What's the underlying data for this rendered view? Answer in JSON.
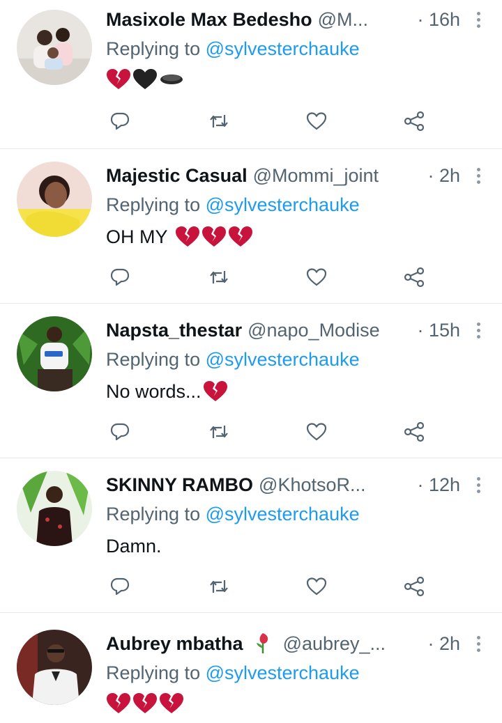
{
  "reply_prefix": "Replying to",
  "colors": {
    "accent": "#1d9bf0",
    "secondary_text": "#536471",
    "broken_heart": "#c8143c"
  },
  "tweets": [
    {
      "name": "Masixole Max Bedesho",
      "handle": "@M...",
      "time": "· 16h",
      "replying_to": "@sylvesterchauke",
      "text": "",
      "emoji": [
        "broken-heart",
        "black-heart",
        "hole"
      ]
    },
    {
      "name": "Majestic Casual",
      "handle": "@Mommi_joint",
      "time": "· 2h",
      "replying_to": "@sylvesterchauke",
      "text": "OH MY",
      "emoji": [
        "broken-heart",
        "broken-heart",
        "broken-heart"
      ]
    },
    {
      "name": "Napsta_thestar",
      "handle": "@napo_Modise",
      "time": "· 15h",
      "replying_to": "@sylvesterchauke",
      "text": "No words...",
      "emoji": [
        "broken-heart"
      ]
    },
    {
      "name": "SKINNY RAMBO",
      "handle": "@KhotsoR...",
      "time": "· 12h",
      "replying_to": "@sylvesterchauke",
      "text": "Damn.",
      "emoji": []
    },
    {
      "name": "Aubrey mbatha",
      "name_emoji": "rose",
      "handle": "@aubrey_...",
      "time": "· 2h",
      "replying_to": "@sylvesterchauke",
      "text": "",
      "emoji": [
        "broken-heart",
        "broken-heart",
        "broken-heart"
      ]
    }
  ],
  "action_icons": [
    "reply-icon",
    "retweet-icon",
    "like-icon",
    "share-icon"
  ]
}
